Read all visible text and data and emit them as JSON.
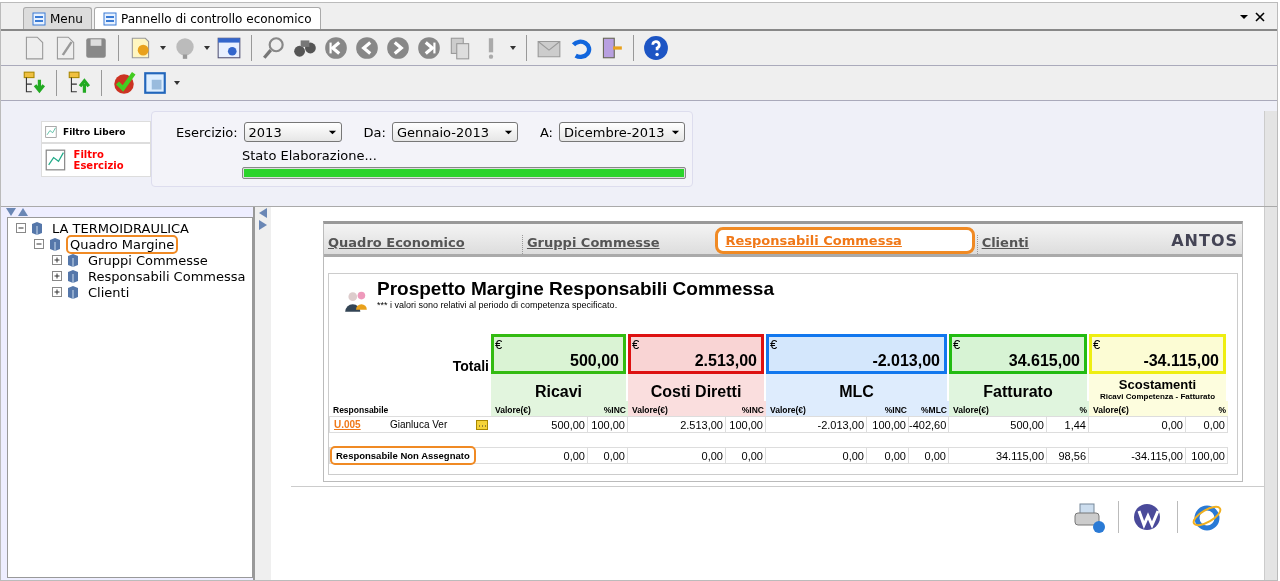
{
  "window_tabs": [
    {
      "label": "Menu",
      "selected": false
    },
    {
      "label": "Pannello di controllo economico",
      "selected": true
    }
  ],
  "filters": [
    {
      "label": "Filtro Libero",
      "selected": false
    },
    {
      "label": "Filtro Esercizio",
      "selected": true
    }
  ],
  "fields": [
    {
      "label": "Esercizio:",
      "value": "2013"
    },
    {
      "label": "Da:",
      "value": "Gennaio-2013"
    },
    {
      "label": "A:",
      "value": "Dicembre-2013"
    }
  ],
  "progress": {
    "label": "Stato Elaborazione...",
    "level": 1
  },
  "tree": [
    {
      "label": "LA TERMOIDRAULICA",
      "expanded": true,
      "highlighted": false,
      "children": [
        {
          "label": "Quadro Margine",
          "expanded": true,
          "highlighted": true,
          "children": [
            {
              "label": "Gruppi Commesse",
              "expanded": false,
              "highlighted": false
            },
            {
              "label": "Responsabili Commessa",
              "expanded": false,
              "highlighted": false
            },
            {
              "label": "Clienti",
              "expanded": false,
              "highlighted": false
            }
          ]
        }
      ]
    }
  ],
  "report_tabs": [
    {
      "label": "Quadro Economico",
      "selected": false,
      "highlighted": false
    },
    {
      "label": "Gruppi Commesse",
      "selected": false,
      "highlighted": false
    },
    {
      "label": "Responsabili Commessa",
      "selected": true,
      "highlighted": true
    },
    {
      "label": "Clienti",
      "selected": false,
      "highlighted": false
    }
  ],
  "brand": "ANTOS",
  "report": {
    "title": "Prospetto Margine Responsabili Commessa",
    "note": "*** i valori sono relativi al periodo di competenza specificato.",
    "totals_label": "Totali",
    "currency": "€",
    "row_header": "Responsabile",
    "groups": [
      {
        "name": "Ricavi",
        "color": "#33bb11",
        "total": "500,00",
        "columns": [
          "Valore(€)",
          "%INC"
        ]
      },
      {
        "name": "Costi Diretti",
        "color": "#dd1111",
        "total": "2.513,00",
        "columns": [
          "Valore(€)",
          "%INC"
        ]
      },
      {
        "name": "MLC",
        "color": "#1177ee",
        "total": "-2.013,00",
        "columns": [
          "Valore(€)",
          "%INC",
          "%MLC"
        ]
      },
      {
        "name": "Fatturato",
        "color": "#22bb11",
        "total": "34.615,00",
        "columns": [
          "Valore(€)",
          "%"
        ]
      },
      {
        "name": "Scostamenti",
        "subtitle": "Ricavi Competenza - Fatturato",
        "color": "#eeee11",
        "total": "-34.115,00",
        "columns": [
          "Valore(€)",
          "%"
        ]
      }
    ],
    "rows": [
      {
        "kind": "person",
        "code": "U.005",
        "name": "Gianluca Ver",
        "values": [
          "500,00",
          "100,00",
          "2.513,00",
          "100,00",
          "-2.013,00",
          "100,00",
          "-402,60",
          "500,00",
          "1,44",
          "0,00",
          "0,00"
        ]
      },
      {
        "kind": "unassigned",
        "label": "Responsabile Non Assegnato",
        "highlighted": true,
        "values": [
          "0,00",
          "0,00",
          "0,00",
          "0,00",
          "0,00",
          "0,00",
          "0,00",
          "34.115,00",
          "98,56",
          "-34.115,00",
          "100,00"
        ]
      }
    ]
  }
}
